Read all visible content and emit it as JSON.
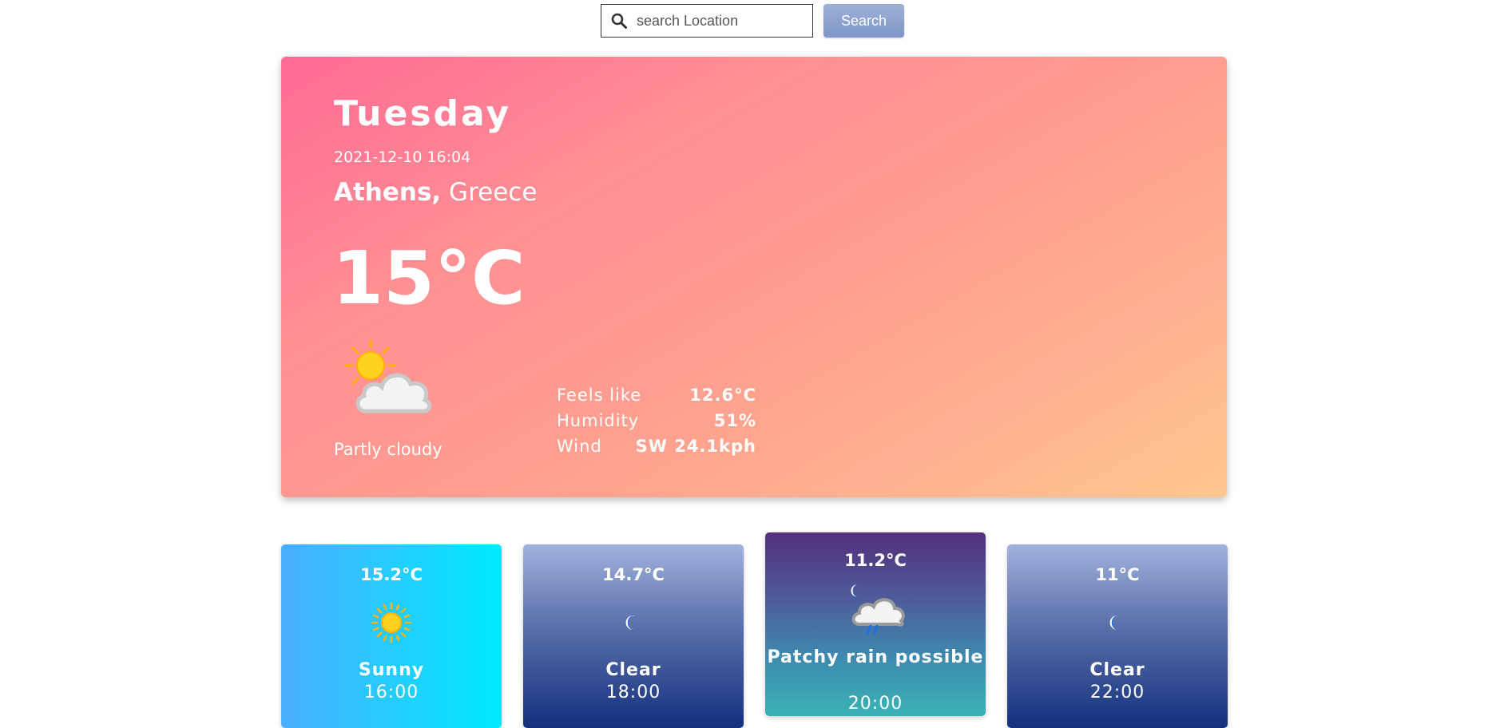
{
  "search": {
    "placeholder": "search Location",
    "button_label": "Search"
  },
  "current": {
    "day": "Tuesday",
    "datetime": "2021-12-10 16:04",
    "city": "Athens,",
    "country": " Greece",
    "temperature": "15°C",
    "condition": "Partly cloudy",
    "icon": "partly-cloudy-icon",
    "stats": [
      {
        "label": "Feels like",
        "value": "12.6°C"
      },
      {
        "label": "Humidity",
        "value": "51%"
      },
      {
        "label": "Wind",
        "value": "SW 24.1kph"
      }
    ]
  },
  "forecast": [
    {
      "temp": "15.2°C",
      "condition": "Sunny",
      "time": "16:00",
      "icon": "sun-icon",
      "gradient": [
        "#4aaeff",
        "#00eaff"
      ]
    },
    {
      "temp": "14.7°C",
      "condition": "Clear",
      "time": "18:00",
      "icon": "moon-icon",
      "gradient": [
        "#a0b2dd",
        "#13317e"
      ]
    },
    {
      "temp": "11.2°C",
      "condition": "Patchy rain possible",
      "time": "20:00",
      "icon": "night-rain-cloud-icon",
      "gradient": [
        "#53307c",
        "#3ab3b4"
      ]
    },
    {
      "temp": "11°C",
      "condition": "Clear",
      "time": "22:00",
      "icon": "moon-icon",
      "gradient": [
        "#a0b2dd",
        "#13317e"
      ]
    }
  ],
  "colors": {
    "main_gradient": [
      "#ff6a95",
      "#ffc690"
    ],
    "search_button": "#8ea3cf"
  }
}
